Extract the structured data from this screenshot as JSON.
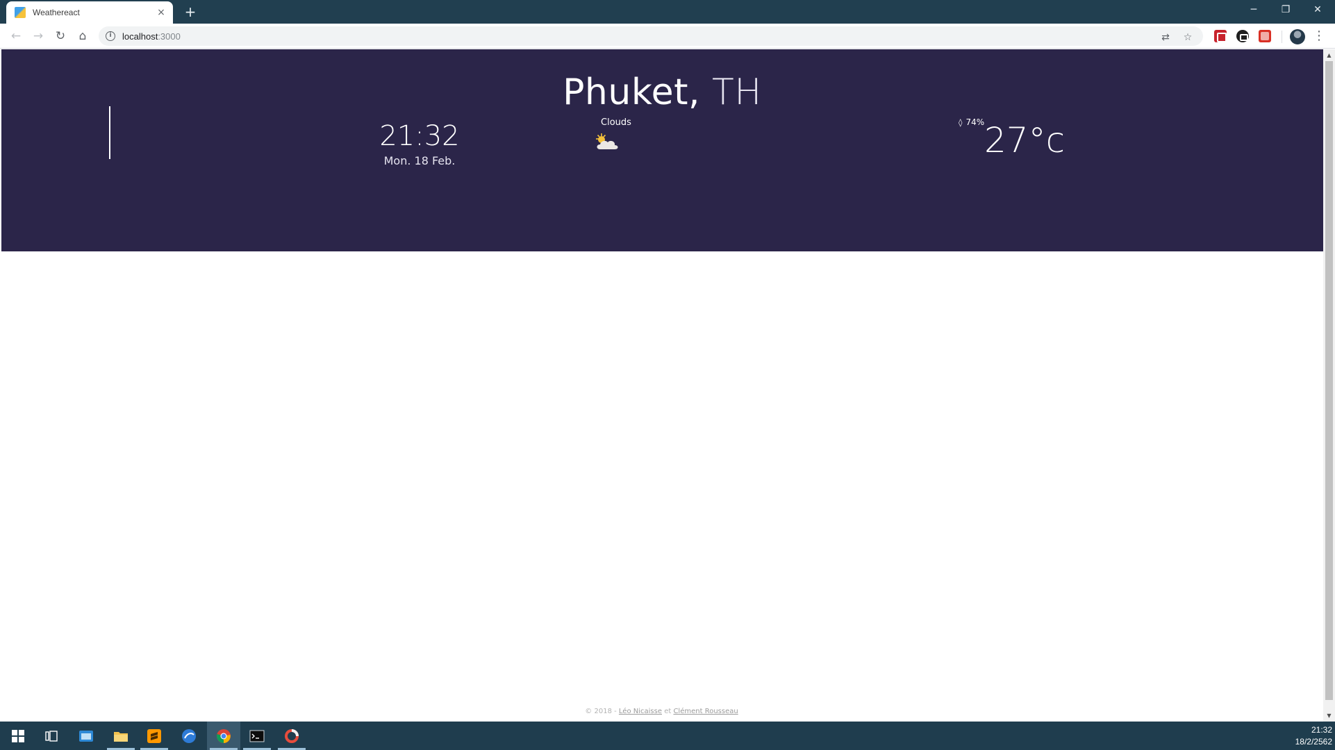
{
  "browser": {
    "tab_title": "Weathereact",
    "tab_close_glyph": "×",
    "new_tab_glyph": "+",
    "url_host": "localhost",
    "url_port": ":3000",
    "window_controls": {
      "minimize": "─",
      "restore": "❐",
      "close": "✕"
    }
  },
  "page": {
    "city": "Phuket",
    "separator": ",",
    "country": "TH",
    "time": "21:32",
    "date": "Mon. 18 Feb.",
    "condition": "Clouds",
    "condition_icon": "sun-behind-cloud-icon",
    "humidity": "74%",
    "temperature": "27°c",
    "footer": {
      "prefix": "© 2018 -",
      "author1": "Léo Nicaisse",
      "conjunction": "et",
      "author2": "Clément Rousseau"
    },
    "colors": {
      "hero_background": "#2b2549",
      "text": "#ffffff"
    }
  },
  "taskbar": {
    "clock_time": "21:32",
    "clock_date": "18/2/2562"
  }
}
